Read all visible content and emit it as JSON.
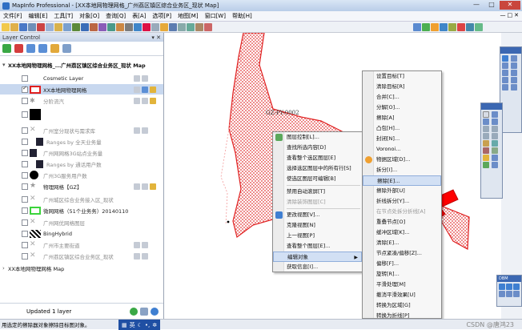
{
  "window": {
    "title": "MapInfo Professional - [XX本地网物理网格_广州荔区镇区综合业务区_现状 Map]",
    "min_glyph": "—",
    "max_glyph": "□",
    "close_glyph": "✕"
  },
  "menubar": {
    "items": [
      "文件[F]",
      "编辑[E]",
      "工具[T]",
      "对象[O]",
      "查询[Q]",
      "表[A]",
      "选项[P]",
      "地图[M]",
      "窗口[W]",
      "帮助[H]"
    ],
    "right_glyphs": [
      "—",
      "□",
      "✕"
    ]
  },
  "layer_control": {
    "title": "Layer Control",
    "pin_glyph": "▾ ✕",
    "group_name": "XX本地网物理网格_...广州荔区镇区综合业务区_现状 Map",
    "layers": [
      {
        "label": "Cosmetic Layer",
        "checked": false,
        "disabled": false,
        "symbol": "none"
      },
      {
        "label": "XX本地网物理网格",
        "checked": true,
        "disabled": false,
        "symbol": "red-outline",
        "selected": true
      },
      {
        "label": "分阶流汽",
        "checked": false,
        "disabled": true,
        "symbol": "gray-stars"
      },
      {
        "label": "",
        "checked": false,
        "disabled": true,
        "symbol": "black-shapes"
      },
      {
        "label": "广州室分现状与需求库",
        "checked": false,
        "disabled": true,
        "symbol": "gray-x"
      },
      {
        "label": "Ranges by 全天业务量",
        "checked": false,
        "disabled": true,
        "symbol": "square-dark"
      },
      {
        "label": "广州网网格3G站点业务量",
        "checked": false,
        "disabled": true,
        "symbol": "square-dark"
      },
      {
        "label": "Ranges by 通话用户数",
        "checked": false,
        "disabled": true,
        "symbol": "square-dark"
      },
      {
        "label": "广州3G服务用户数",
        "checked": false,
        "disabled": true,
        "symbol": "black-dot"
      },
      {
        "label": "物理网格【GZ】",
        "checked": false,
        "disabled": false,
        "symbol": "gray-star"
      },
      {
        "label": "广州城区综合业务接入区_现状",
        "checked": false,
        "disabled": true,
        "symbol": "gray-x"
      },
      {
        "label": "微网网格（51个业务务）20140110",
        "checked": false,
        "disabled": false,
        "symbol": "green-outline"
      },
      {
        "label": "广州网优网格图层",
        "checked": false,
        "disabled": true,
        "symbol": "gray-x"
      },
      {
        "label": "BingHybrid",
        "checked": false,
        "disabled": false,
        "symbol": "checker"
      },
      {
        "label": "广州市主要街道",
        "checked": false,
        "disabled": true,
        "symbol": "gray-x"
      },
      {
        "label": "广州荔区镇区综合业务区_现状",
        "checked": false,
        "disabled": true,
        "symbol": "gray-x"
      }
    ],
    "collapsed_group": "XX本地网物理网格 Map",
    "status": "Updated 1 layer"
  },
  "map": {
    "label": "GZ-PY-0002"
  },
  "context_menu": {
    "items": [
      {
        "label": "图层控制[L]...",
        "type": "item",
        "icon": true
      },
      {
        "label": "查找所选内容[D]",
        "type": "item"
      },
      {
        "label": "查看整个选区图层[E]",
        "type": "item"
      },
      {
        "label": "选择选区图层中的所有行[S]",
        "type": "item"
      },
      {
        "label": "使选区图层可编辑[B]",
        "type": "item"
      },
      {
        "label": "禁用自动滚屏[T]",
        "type": "item"
      },
      {
        "label": "清除装饰图层[C]",
        "type": "disabled"
      },
      {
        "label": "更改视图[V]...",
        "type": "item",
        "icon": true
      },
      {
        "label": "克隆视图[N]",
        "type": "item"
      },
      {
        "label": "上一视图[P]",
        "type": "item"
      },
      {
        "label": "查看整个图层[E]...",
        "type": "item"
      },
      {
        "label": "编辑对象",
        "type": "submenu",
        "highlight": true
      },
      {
        "label": "获取信息[I]...",
        "type": "item"
      }
    ]
  },
  "submenu": {
    "items": [
      {
        "label": "设置目标[T]",
        "type": "item"
      },
      {
        "label": "清除目标[R]",
        "type": "item"
      },
      {
        "label": "合并[C]...",
        "type": "item"
      },
      {
        "label": "分解[O]...",
        "type": "item"
      },
      {
        "label": "擦除[A]",
        "type": "item"
      },
      {
        "label": "凸包[H]...",
        "type": "item"
      },
      {
        "label": "封闭[N]...",
        "type": "item"
      },
      {
        "label": "Voronoi...",
        "type": "item"
      },
      {
        "label": "物据区域[D]...",
        "type": "item",
        "icon": true
      },
      {
        "label": "拆分[I]...",
        "type": "item"
      },
      {
        "label": "擦除[E]...",
        "type": "item",
        "highlight": true
      },
      {
        "label": "擦除外部[U]",
        "type": "item"
      },
      {
        "label": "折线拆分[Y]...",
        "type": "item"
      },
      {
        "label": "在节点处拆分折线[A]",
        "type": "disabled"
      },
      {
        "label": "重叠节点[O]",
        "type": "item"
      },
      {
        "label": "缓冲区域[K]...",
        "type": "item"
      },
      {
        "label": "清除[E]...",
        "type": "item"
      },
      {
        "label": "节点紧凑/偏移[Z]...",
        "type": "item"
      },
      {
        "label": "偏移[F]...",
        "type": "item"
      },
      {
        "label": "旋转[R]...",
        "type": "item"
      },
      {
        "label": "平滑处理[M]",
        "type": "item"
      },
      {
        "label": "撤消平滑效果[U]",
        "type": "item"
      },
      {
        "label": "转换为区域[G]",
        "type": "item"
      },
      {
        "label": "转换为折线[P]",
        "type": "item"
      }
    ]
  },
  "statusbar": {
    "text": "用选定的擦除器对象擦除目标图对象。",
    "ime": "英",
    "watermark": "CSDN @唐鸿23"
  },
  "floating": {
    "dbm_title": "DBM"
  },
  "colors": {
    "accent": "#2f6fc4",
    "polygon_fill": "#f7c7c7",
    "polygon_stroke": "#e02020",
    "arrow": "#ff0000"
  }
}
